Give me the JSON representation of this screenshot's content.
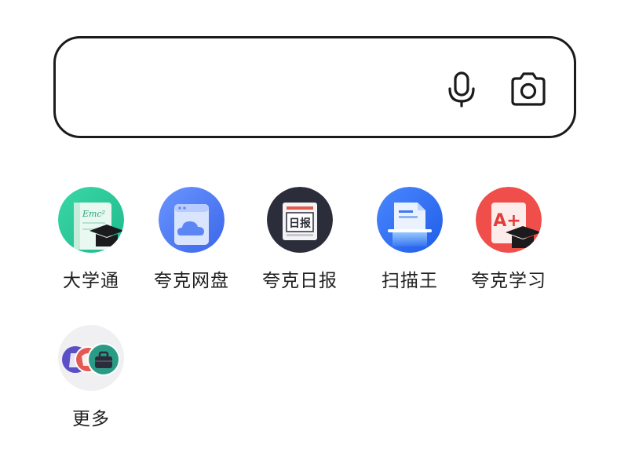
{
  "search": {
    "placeholder": "",
    "value": "",
    "voice_icon": "microphone-icon",
    "camera_icon": "camera-icon"
  },
  "apps": [
    {
      "label": "大学通",
      "icon": "graduation-cap-notebook-icon",
      "color": "#2cc79a"
    },
    {
      "label": "夸克网盘",
      "icon": "cloud-folder-icon",
      "color": "#4a7cf6"
    },
    {
      "label": "夸克日报",
      "icon": "newspaper-icon",
      "color": "#2b2d3a",
      "icon_text": "日报"
    },
    {
      "label": "扫描王",
      "icon": "document-scan-icon",
      "color": "#2f6ef5"
    },
    {
      "label": "夸克学习",
      "icon": "a-plus-graduation-icon",
      "color": "#ef4e4a",
      "icon_text": "A+"
    }
  ],
  "more": {
    "label": "更多",
    "icon": "more-apps-stack-icon"
  }
}
